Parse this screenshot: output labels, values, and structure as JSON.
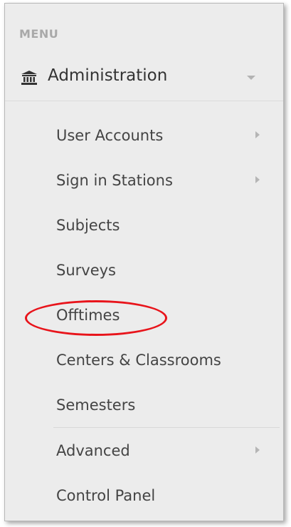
{
  "menu": {
    "header": "MENU",
    "group": {
      "label": "Administration",
      "icon": "bank-icon",
      "expanded": true
    },
    "items": [
      {
        "label": "User Accounts",
        "has_submenu": true
      },
      {
        "label": "Sign in Stations",
        "has_submenu": true
      },
      {
        "label": "Subjects",
        "has_submenu": false
      },
      {
        "label": "Surveys",
        "has_submenu": false
      },
      {
        "label": "Offtimes",
        "has_submenu": false,
        "highlighted": true
      },
      {
        "label": "Centers & Classrooms",
        "has_submenu": false
      },
      {
        "label": "Semesters",
        "has_submenu": false
      },
      {
        "label": "Advanced",
        "has_submenu": true
      },
      {
        "label": "Control Panel",
        "has_submenu": false
      }
    ]
  },
  "colors": {
    "panel_background": "#ececec",
    "text": "#444444",
    "header_text": "#a9a9a9",
    "highlight": "#e8141b"
  }
}
